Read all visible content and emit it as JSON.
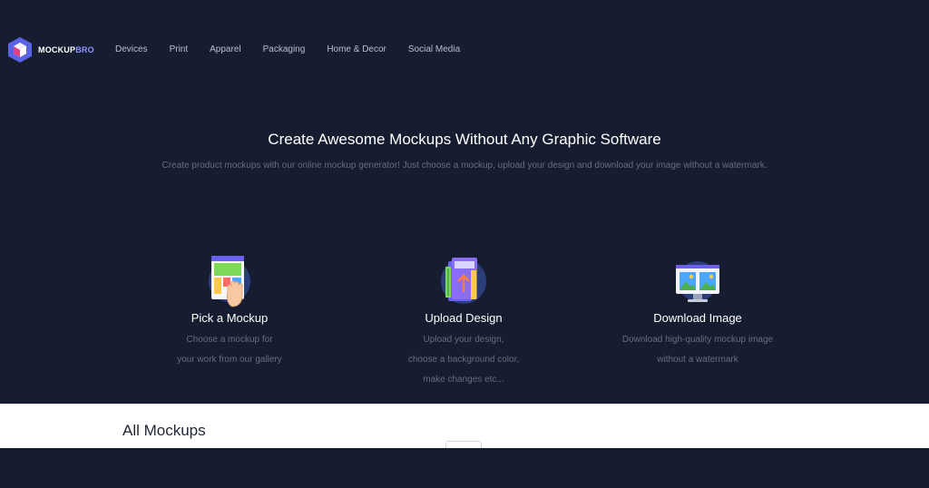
{
  "brand": {
    "name_part1": "MOCKUP",
    "name_part2": "BRO",
    "accent_color": "#8d96ff"
  },
  "nav": {
    "items": [
      {
        "label": "Devices"
      },
      {
        "label": "Print"
      },
      {
        "label": "Apparel"
      },
      {
        "label": "Packaging"
      },
      {
        "label": "Home & Decor"
      },
      {
        "label": "Social Media"
      }
    ]
  },
  "hero": {
    "title": "Create Awesome Mockups Without Any Graphic Software",
    "subtitle": "Create product mockups with our online mockup generator! Just choose a mockup, upload your design and download your image without a watermark."
  },
  "steps": [
    {
      "icon": "gallery-hand-icon",
      "title": "Pick a Mockup",
      "desc_lines": [
        "Choose a mockup for",
        "your work from our gallery"
      ]
    },
    {
      "icon": "upload-book-icon",
      "title": "Upload Design",
      "desc_lines": [
        "Upload your design,",
        "choose a background color,",
        "make changes etc..."
      ]
    },
    {
      "icon": "monitor-images-icon",
      "title": "Download Image",
      "desc_lines": [
        "Download high-quality mockup image",
        "without a watermark"
      ]
    }
  ],
  "section": {
    "title": "All Mockups"
  },
  "colors": {
    "background": "#171d30",
    "text_muted": "#646c86",
    "panel": "#ffffff"
  }
}
